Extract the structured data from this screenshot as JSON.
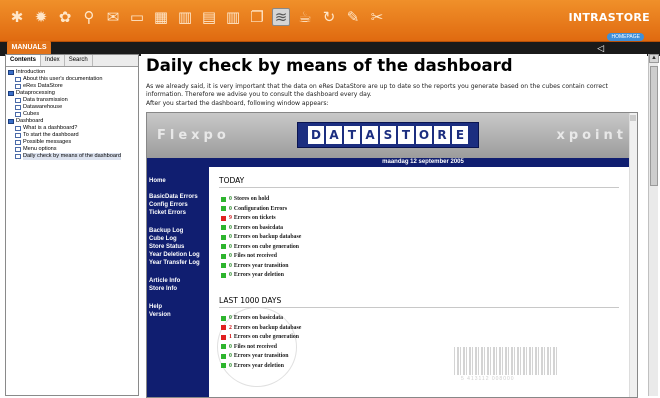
{
  "toolbar": {
    "icons": [
      "star-icon",
      "sun-icon",
      "flower-icon",
      "magnifier-icon",
      "envelope-icon",
      "monitor-icon",
      "calendar-icon",
      "chart-icon",
      "document-icon",
      "columns-icon",
      "copy-icon",
      "stack-icon",
      "cup-icon",
      "refresh-icon",
      "edit-icon",
      "tools-icon"
    ],
    "brand": "INTRASTORE",
    "homepage_label": "HOMEPAGE",
    "back_glyph": "◁"
  },
  "manuals_tab": "MANUALS",
  "left_panel": {
    "tabs": [
      "Contents",
      "Index",
      "Search"
    ],
    "tree": [
      {
        "label": "Introduction",
        "type": "book",
        "level": 0
      },
      {
        "label": "About this user's documentation",
        "type": "page",
        "level": 1
      },
      {
        "label": "eRes DataStore",
        "type": "page",
        "level": 1
      },
      {
        "label": "Dataprocessing",
        "type": "book",
        "level": 0
      },
      {
        "label": "Data transmission",
        "type": "page",
        "level": 1
      },
      {
        "label": "Datawarehouse",
        "type": "page",
        "level": 1
      },
      {
        "label": "Cubes",
        "type": "page",
        "level": 1
      },
      {
        "label": "Dashboard",
        "type": "book",
        "level": 0
      },
      {
        "label": "What is a dashboard?",
        "type": "page",
        "level": 1
      },
      {
        "label": "To start the dashboard",
        "type": "page",
        "level": 1
      },
      {
        "label": "Possible messages",
        "type": "page",
        "level": 1
      },
      {
        "label": "Menu options",
        "type": "page",
        "level": 1
      },
      {
        "label": "Daily check by means of the dashboard",
        "type": "page",
        "level": 1,
        "selected": true
      }
    ]
  },
  "content": {
    "title": "Daily check by means of the dashboard",
    "paragraph1": "As we already said, it is very important that the data on eRes DataStore are up to date so the reports you generate based on the cubes contain correct information. Therefore we advise you to consult the dashboard every day.",
    "paragraph2": "After you started the dashboard, following window appears:"
  },
  "dashboard": {
    "header_left": "Flexpo",
    "header_right": "xpoint",
    "logo_letters": [
      "D",
      "A",
      "T",
      "A",
      "S",
      "T",
      "O",
      "R",
      "E"
    ],
    "date": "maandag 12 september 2005",
    "nav": [
      "Home",
      "BasicData Errors",
      "Config Errors",
      "Ticket Errors",
      "Backup Log",
      "Cube Log",
      "Store Status",
      "Year Deletion Log",
      "Year Transfer Log",
      "Article Info",
      "Store Info",
      "Help",
      "Version"
    ],
    "today": {
      "title": "TODAY",
      "rows": [
        {
          "count": "0",
          "text": "Stores on hold",
          "status": "ok"
        },
        {
          "count": "0",
          "text": "Configuration Errors",
          "status": "ok"
        },
        {
          "count": "9",
          "text": "Errors on tickets",
          "status": "bad"
        },
        {
          "count": "0",
          "text": "Errors on basicdata",
          "status": "ok"
        },
        {
          "count": "0",
          "text": "Errors on backup database",
          "status": "ok"
        },
        {
          "count": "0",
          "text": "Errors on cube generation",
          "status": "ok"
        },
        {
          "count": "0",
          "text": "Files not received",
          "status": "ok"
        },
        {
          "count": "0",
          "text": "Errors year transition",
          "status": "ok"
        },
        {
          "count": "0",
          "text": "Errors year deletion",
          "status": "ok"
        }
      ]
    },
    "last1000": {
      "title": "LAST 1000 DAYS",
      "rows": [
        {
          "count": "0",
          "text": "Errors on basicdata",
          "status": "ok"
        },
        {
          "count": "2",
          "text": "Errors on backup database",
          "status": "bad"
        },
        {
          "count": "1",
          "text": "Errors on cube generation",
          "status": "bad"
        },
        {
          "count": "0",
          "text": "Files not received",
          "status": "ok"
        },
        {
          "count": "0",
          "text": "Errors year transition",
          "status": "ok"
        },
        {
          "count": "0",
          "text": "Errors year deletion",
          "status": "ok"
        }
      ]
    },
    "barcode_text": "5 413112 008000"
  },
  "colors": {
    "toolbar_orange": "#e8781a",
    "dashboard_navy": "#101e70",
    "ok_green": "#2db52d",
    "error_red": "#e02020"
  }
}
